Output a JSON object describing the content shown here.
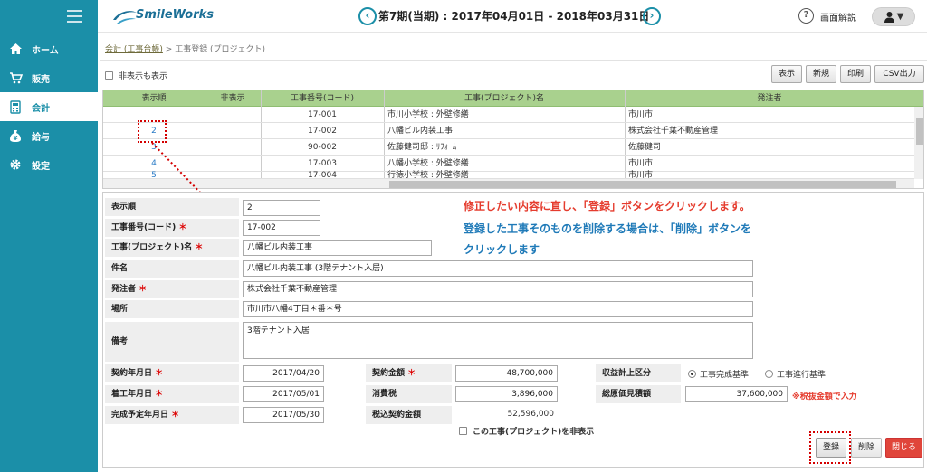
{
  "brand": {
    "name": "SmileWorks"
  },
  "header": {
    "period": "第7期(当期) : 2017年04月01日 - 2018年03月31日",
    "prev": "‹",
    "next": "›",
    "help": "画面解説",
    "help_icon": "?",
    "user_caret": "▼"
  },
  "sidebar": {
    "items": [
      {
        "label": "ホーム",
        "icon": "home-icon"
      },
      {
        "label": "販売",
        "icon": "cart-icon"
      },
      {
        "label": "会計",
        "icon": "calculator-icon"
      },
      {
        "label": "給与",
        "icon": "money-bag-icon"
      },
      {
        "label": "設定",
        "icon": "gear-icon"
      }
    ],
    "active_index": 2
  },
  "breadcrumb": {
    "parent": "会計 (工事台帳)",
    "sep": ">",
    "current": "工事登録 (プロジェクト)"
  },
  "toolbar": {
    "show_hidden_label": "非表示も表示",
    "buttons": [
      "表示",
      "新規",
      "印刷",
      "CSV出力"
    ]
  },
  "grid": {
    "columns": [
      "表示順",
      "非表示",
      "工事番号(コード)",
      "工事(プロジェクト)名",
      "発注者"
    ],
    "rows": [
      {
        "order": "",
        "hidden": "",
        "code": "17-001",
        "name": "市川小学校 : 外壁修繕",
        "client": "市川市"
      },
      {
        "order": "2",
        "hidden": "",
        "code": "17-002",
        "name": "八幡ビル内装工事",
        "client": "株式会社千葉不動産管理"
      },
      {
        "order": "3",
        "hidden": "",
        "code": "90-002",
        "name": "佐藤健司邸 : ﾘﾌｫｰﾑ",
        "client": "佐藤健司"
      },
      {
        "order": "4",
        "hidden": "",
        "code": "17-003",
        "name": "八幡小学校 : 外壁修繕",
        "client": "市川市"
      },
      {
        "order": "5",
        "hidden": "",
        "code": "17-004",
        "name": "行徳小学校 : 外壁修繕",
        "client": "市川市"
      }
    ]
  },
  "form": {
    "order": {
      "label": "表示順",
      "value": "2"
    },
    "code": {
      "label": "工事番号(コード)",
      "value": "17-002"
    },
    "name": {
      "label": "工事(プロジェクト)名",
      "value": "八幡ビル内装工事"
    },
    "subject": {
      "label": "件名",
      "value": "八幡ビル内装工事 (3階テナント入居)"
    },
    "client": {
      "label": "発注者",
      "value": "株式会社千葉不動産管理"
    },
    "place": {
      "label": "場所",
      "value": "市川市八幡4丁目＊番＊号"
    },
    "remarks": {
      "label": "備考",
      "value": "3階テナント入居"
    },
    "contract_date": {
      "label": "契約年月日",
      "value": "2017/04/20"
    },
    "start_date": {
      "label": "着工年月日",
      "value": "2017/05/01"
    },
    "end_date": {
      "label": "完成予定年月日",
      "value": "2017/05/30"
    },
    "contract_amount": {
      "label": "契約金額",
      "value": "48,700,000"
    },
    "tax": {
      "label": "消費税",
      "value": "3,896,000"
    },
    "total_with_tax": {
      "label": "税込契約金額",
      "value": "52,596,000"
    },
    "revenue_type": {
      "label": "収益計上区分",
      "options": [
        "工事完成基準",
        "工事進行基準"
      ],
      "selected": 0
    },
    "cost_estimate": {
      "label": "総原価見積額",
      "value": "37,600,000",
      "note": "※税抜金額で入力"
    },
    "hide_project_label": "この工事(プロジェクト)を非表示",
    "required_mark": "＊"
  },
  "annotation": {
    "line1": "修正したい内容に直し、「登録」ボタンをクリックします。",
    "line2": "登録した工事そのものを削除する場合は、「削除」ボタンを",
    "line3": "クリックします"
  },
  "actions": {
    "register": "登録",
    "delete": "削除",
    "close": "閉じる"
  },
  "colors": {
    "sidebar": "#1b8fa8",
    "grid_header": "#a9d18e",
    "close_button": "#e0453a",
    "annotation_blue": "#1f7ab8",
    "annotation_red": "#e53c2e"
  }
}
